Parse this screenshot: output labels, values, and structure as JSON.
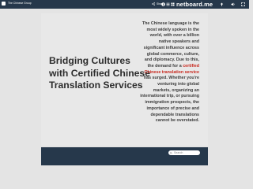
{
  "header": {
    "brand_name": "The Chinese Group",
    "share_label": "Share",
    "site_name": "netboard.me",
    "icons": [
      "share-icon",
      "info-icon",
      "list-icon",
      "grid-icon",
      "upload-icon",
      "volume-icon",
      "fullscreen-icon"
    ]
  },
  "main": {
    "headline": "Bridging Cultures with Certified Chinese Translation Services",
    "paragraph": {
      "before": "The Chinese language is the most widely spoken in the world, with over a billion native speakers and significant influence across global commerce, culture, and diplomacy. Due to this, the demand for a ",
      "highlight": "certified Chinese translation service",
      "after": " has surged. Whether you're venturing into global markets, organizing an international trip, or pursuing immigration prospects, the importance of precise and dependable translations cannot be overstated."
    }
  },
  "footer": {
    "search_placeholder": "Search"
  },
  "colors": {
    "bar": "#26384b",
    "background": "#e4e4e4",
    "highlight": "#c8281e"
  }
}
